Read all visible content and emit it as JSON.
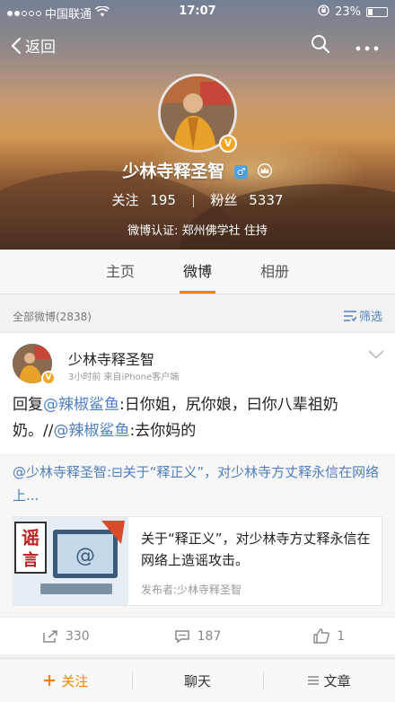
{
  "status_bar": {
    "carrier": "中国联通",
    "time": "17:07",
    "battery_percent": "23%",
    "battery_level": 0.23,
    "signal_bars_on": 2,
    "signal_bars_total": 5
  },
  "nav": {
    "back_label": "返回"
  },
  "profile": {
    "name": "少林寺释圣智",
    "gender_symbol": "♂",
    "following_label": "关注",
    "following_count": "195",
    "fans_label": "粉丝",
    "fans_count": "5337",
    "verification": "微博认证: 郑州佛学社 住持"
  },
  "tabs": [
    {
      "label": "主页",
      "active": false
    },
    {
      "label": "微博",
      "active": true
    },
    {
      "label": "相册",
      "active": false
    }
  ],
  "filter": {
    "count_label": "全部微博(2838)",
    "filter_label": "筛选"
  },
  "post": {
    "author": "少林寺释圣智",
    "meta": "3小时前  来自iPhone客户端",
    "content": {
      "prefix": "回复",
      "mention1": "@辣椒鲨鱼",
      "text1": ":日你姐，尻你娘，曰你八辈祖奶奶。//",
      "mention2": "@辣椒鲨鱼",
      "text2": ":去你妈的"
    },
    "repost": {
      "mention": "@少林寺释圣智",
      "text": ":⊟关于“释正义”，对少林寺方丈释永信在网络上..."
    },
    "card": {
      "title": "关于“释正义”，对少林寺方丈释永信在网络上造谣攻击。",
      "publisher": "发布者:少林寺释圣智",
      "thumb_label_big": "谣",
      "thumb_label_small": "言"
    }
  },
  "actions": {
    "repost_count": "330",
    "comment_count": "187",
    "like_count": "1"
  },
  "bottom_bar": {
    "follow_label": "关注",
    "chat_label": "聊天",
    "article_label": "文章"
  },
  "colors": {
    "accent": "#f08400",
    "link": "#4f7fbf",
    "vip_badge": "#f6a623",
    "gender_badge": "#4aa3f0"
  }
}
